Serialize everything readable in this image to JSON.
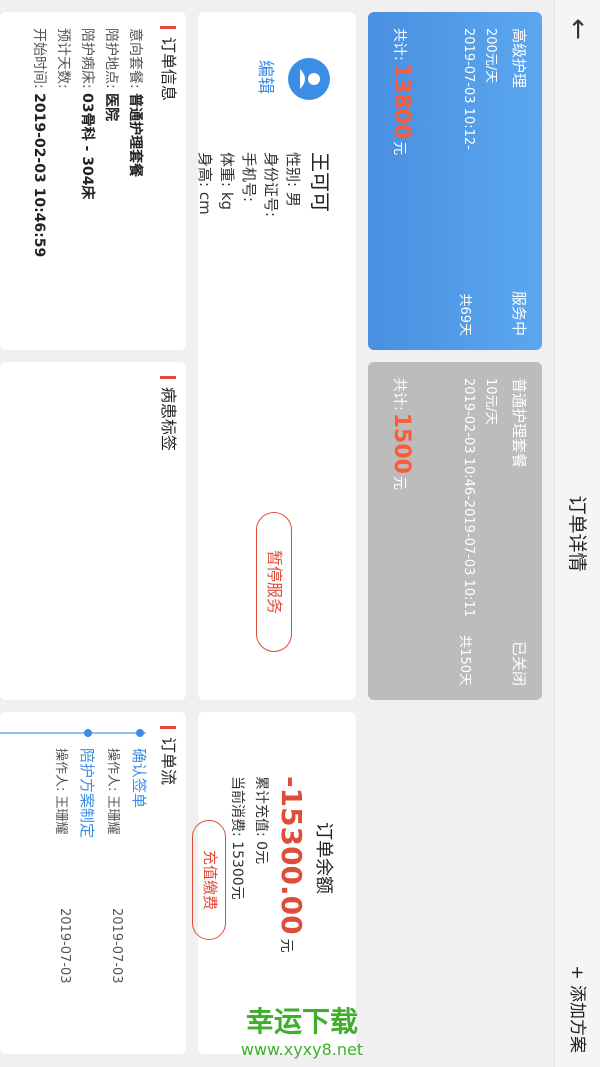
{
  "header": {
    "back_icon": "arrow-left-icon",
    "title": "订单详情",
    "add_plan": "+ 添加方案"
  },
  "plans": [
    {
      "name": "高级护理",
      "status": "服务中",
      "price": "200元/天",
      "period": "2019-07-03 10:12-",
      "days": "共69天",
      "total_prefix": "共计:",
      "total": "13800",
      "total_unit": "元"
    },
    {
      "name": "普通护理套餐",
      "status": "已关闭",
      "price": "10元/天",
      "period": "2019-02-03 10:46-2019-07-03 10:11",
      "days": "共150天",
      "total_prefix": "共计:",
      "total": "1500",
      "total_unit": "元"
    }
  ],
  "person": {
    "name": "王可可",
    "edit": "编辑",
    "gender": "性别: 男",
    "id": "身份证号:",
    "phone": "手机号:",
    "weight": "体重: kg",
    "height": "身高: cm",
    "stop_button": "暂停服务"
  },
  "balance": {
    "title": "订单余额",
    "amount": "-15300.00",
    "unit": "元",
    "recharged": "累计充值: 0元",
    "consumed": "当前消费: 15300元",
    "recharge_button": "充值缴费"
  },
  "order_info": {
    "title": "订单信息",
    "package_label": "意向套餐:",
    "package": "普通护理套餐",
    "place_label": "陪护地点:",
    "place": "医院",
    "bed_label": "陪护病床:",
    "bed": "03骨科 - 304床",
    "days_label": "预计天数:",
    "start_label": "开始时间:",
    "start": "2019-02-03 10:46:59"
  },
  "tags": {
    "title": "病患标签"
  },
  "flow": {
    "title": "订单流",
    "steps": [
      {
        "name": "确认签单",
        "operator": "操作人:  王珊耀",
        "time": "2019-07-03"
      },
      {
        "name": "陪护方案制定",
        "operator": "操作人:  王珊耀",
        "time": "2019-07-03"
      }
    ]
  },
  "watermark": {
    "text": "幸运下载",
    "url": "www.xyxy8.net"
  }
}
